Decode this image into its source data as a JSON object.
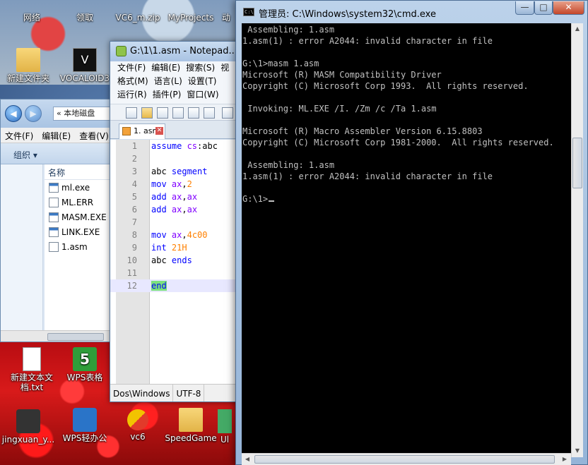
{
  "desktop": {
    "icons": [
      {
        "label": "网络",
        "icon": "network-icon"
      },
      {
        "label": "领取",
        "icon": "gift-icon"
      },
      {
        "label": "VC6_m.zip",
        "icon": "zip-icon"
      },
      {
        "label": "MyProjects",
        "icon": "folder-icon"
      },
      {
        "label": "动",
        "icon": "shortcut-icon"
      },
      {
        "label": "新建文件夹",
        "icon": "folder-icon"
      },
      {
        "label": "VOCALOID3",
        "icon": "app-icon"
      },
      {
        "label": "新建文本文\n档.txt",
        "icon": "text-file-icon"
      },
      {
        "label": "WPS表格",
        "icon": "wps-sheet-icon"
      },
      {
        "label": "jingxuan_y...",
        "icon": "app-icon"
      },
      {
        "label": "WPS轻办公",
        "icon": "wps-office-icon"
      },
      {
        "label": "vc6",
        "icon": "shortcut-icon"
      },
      {
        "label": "SpeedGame",
        "icon": "folder-icon"
      },
      {
        "label": "Ul",
        "icon": "app-icon"
      }
    ]
  },
  "explorer": {
    "address": "« 本地磁盘",
    "menu": [
      "文件(F)",
      "编辑(E)",
      "查看(V)"
    ],
    "organize": "组织 ▾",
    "column_header": "名称",
    "files": [
      {
        "name": "ml.exe",
        "type": "exe"
      },
      {
        "name": "ML.ERR",
        "type": "file"
      },
      {
        "name": "MASM.EXE",
        "type": "exe"
      },
      {
        "name": "LINK.EXE",
        "type": "exe"
      },
      {
        "name": "1.asm",
        "type": "file"
      }
    ]
  },
  "notepad": {
    "title": "G:\\1\\1.asm - Notepad...",
    "menu_rows": [
      [
        "文件(F)",
        "编辑(E)",
        "搜索(S)",
        "视"
      ],
      [
        "格式(M)",
        "语言(L)",
        "设置(T)"
      ],
      [
        "运行(R)",
        "插件(P)",
        "窗口(W)"
      ]
    ],
    "tab_label": "1. asm",
    "code_lines": [
      {
        "n": "1",
        "tokens": [
          [
            "kw",
            "assume "
          ],
          [
            "reg",
            "cs"
          ],
          [
            "",
            ":abc"
          ]
        ]
      },
      {
        "n": "2",
        "tokens": []
      },
      {
        "n": "3",
        "tokens": [
          [
            "",
            "abc "
          ],
          [
            "kw",
            "segment"
          ]
        ]
      },
      {
        "n": "4",
        "tokens": [
          [
            "",
            "    "
          ],
          [
            "kw",
            "mov "
          ],
          [
            "reg",
            "ax"
          ],
          [
            "",
            ","
          ],
          [
            "num",
            "2"
          ]
        ]
      },
      {
        "n": "5",
        "tokens": [
          [
            "",
            "    "
          ],
          [
            "kw",
            "add "
          ],
          [
            "reg",
            "ax"
          ],
          [
            "",
            ","
          ],
          [
            "reg",
            "ax"
          ]
        ]
      },
      {
        "n": "6",
        "tokens": [
          [
            "",
            "    "
          ],
          [
            "kw",
            "add "
          ],
          [
            "reg",
            "ax"
          ],
          [
            "",
            ","
          ],
          [
            "reg",
            "ax"
          ]
        ]
      },
      {
        "n": "7",
        "tokens": []
      },
      {
        "n": "8",
        "tokens": [
          [
            "",
            "    "
          ],
          [
            "kw",
            "mov "
          ],
          [
            "reg",
            "ax"
          ],
          [
            "",
            ","
          ],
          [
            "num",
            "4c00"
          ]
        ]
      },
      {
        "n": "9",
        "tokens": [
          [
            "",
            "    "
          ],
          [
            "kw",
            "int "
          ],
          [
            "num",
            "21H"
          ]
        ]
      },
      {
        "n": "10",
        "tokens": [
          [
            "",
            "abc "
          ],
          [
            "kw",
            "ends"
          ]
        ]
      },
      {
        "n": "11",
        "tokens": []
      },
      {
        "n": "12",
        "tokens": [
          [
            "hl",
            "end"
          ]
        ]
      }
    ],
    "status": [
      "Dos\\Windows",
      "UTF-8"
    ]
  },
  "cmd": {
    "title": "管理员: C:\\Windows\\system32\\cmd.exe",
    "buttons": {
      "minimize": "—",
      "maximize": "□",
      "close": "✕"
    },
    "lines": [
      " Assembling: 1.asm",
      "1.asm(1) : error A2044: invalid character in file",
      "",
      "G:\\1>masm 1.asm",
      "Microsoft (R) MASM Compatibility Driver",
      "Copyright (C) Microsoft Corp 1993.  All rights reserved.",
      "",
      " Invoking: ML.EXE /I. /Zm /c /Ta 1.asm",
      "",
      "Microsoft (R) Macro Assembler Version 6.15.8803",
      "Copyright (C) Microsoft Corp 1981-2000.  All rights reserved.",
      "",
      " Assembling: 1.asm",
      "1.asm(1) : error A2044: invalid character in file",
      "",
      "G:\\1>"
    ]
  }
}
